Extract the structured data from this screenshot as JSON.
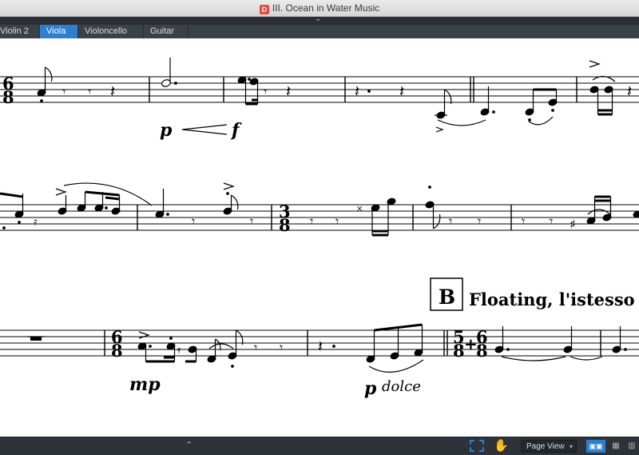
{
  "window": {
    "title": "III. Ocean in Water Music"
  },
  "tabs": [
    {
      "label": "Violin 2",
      "active": false
    },
    {
      "label": "Viola",
      "active": true
    },
    {
      "label": "Violoncello",
      "active": false
    },
    {
      "label": "Guitar",
      "active": false
    }
  ],
  "score": {
    "rehearsal_mark": "B",
    "tempo_text": "Floating, l'istesso t",
    "dynamics": {
      "sys1_p": "p",
      "sys1_f": "f",
      "sys3_mp": "mp",
      "sys3_p": "p",
      "sys3_dolce": "dolce"
    },
    "time_signatures": {
      "sys1": [
        "6",
        "8"
      ],
      "sys2": [
        "3",
        "8"
      ],
      "sys3_a": [
        "6",
        "8"
      ],
      "sys3_b_left": [
        "5",
        "8"
      ],
      "sys3_b_plus": "+",
      "sys3_b_right": [
        "6",
        "8"
      ]
    }
  },
  "statusbar": {
    "view_mode": "Page View",
    "accent": "#2f7fd0"
  }
}
